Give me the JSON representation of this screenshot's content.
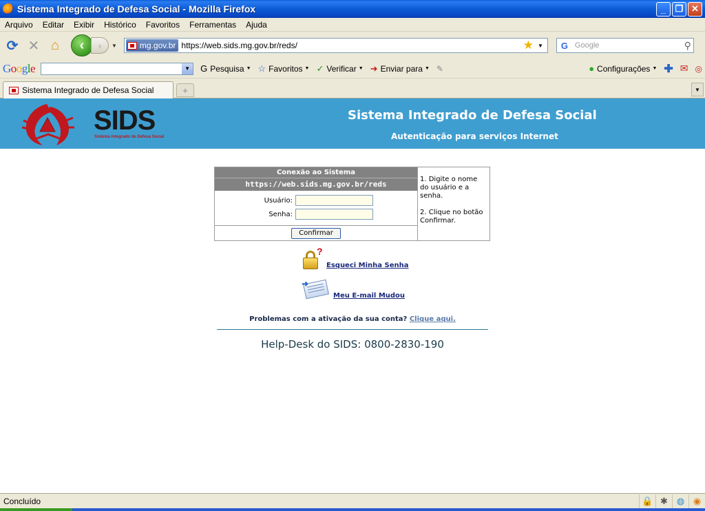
{
  "window": {
    "title": "Sistema Integrado de Defesa Social - Mozilla Firefox",
    "controls": [
      "_",
      "❐",
      "✕"
    ]
  },
  "menu": [
    "Arquivo",
    "Editar",
    "Exibir",
    "Histórico",
    "Favoritos",
    "Ferramentas",
    "Ajuda"
  ],
  "navbar": {
    "identity": "mg.gov.br",
    "url": "https://web.sids.mg.gov.br/reds/",
    "search_placeholder": "Google"
  },
  "google_toolbar": {
    "logo": [
      "G",
      "o",
      "o",
      "g",
      "l",
      "e"
    ],
    "items": {
      "pesquisa": "Pesquisa",
      "favoritos": "Favoritos",
      "verificar": "Verificar",
      "enviar": "Enviar para",
      "configuracoes": "Configurações"
    }
  },
  "tab": {
    "label": "Sistema Integrado de Defesa Social",
    "new_tab": "+"
  },
  "banner": {
    "logo_text": "SIDS",
    "logo_sub": "Sistema Integrado de Defesa Social",
    "title": "Sistema Integrado de Defesa Social",
    "subtitle": "Autenticação para serviços Internet"
  },
  "login": {
    "heading": "Conexão ao Sistema",
    "url": "https://web.sids.mg.gov.br/reds",
    "user_label": "Usuário:",
    "user_value": "",
    "password_label": "Senha:",
    "password_value": "",
    "confirm_label": "Confirmar",
    "help_step1": "1. Digite o nome do usuário e a senha.",
    "help_step2": "2. Clique no botão Confirmar."
  },
  "links": {
    "forgot_password": "Esqueci Minha Senha",
    "email_changed": "Meu E-mail Mudou",
    "problem_text": "Problemas com a ativação da sua conta?",
    "problem_link": "Clique aqui."
  },
  "helpdesk": "Help-Desk do SIDS: 0800-2830-190",
  "status": {
    "text": "Concluído"
  },
  "colors": {
    "banner": "#3f9ed0",
    "login_header": "#828282",
    "link": "#1a2a7a",
    "logo_red": "#c0181e"
  }
}
